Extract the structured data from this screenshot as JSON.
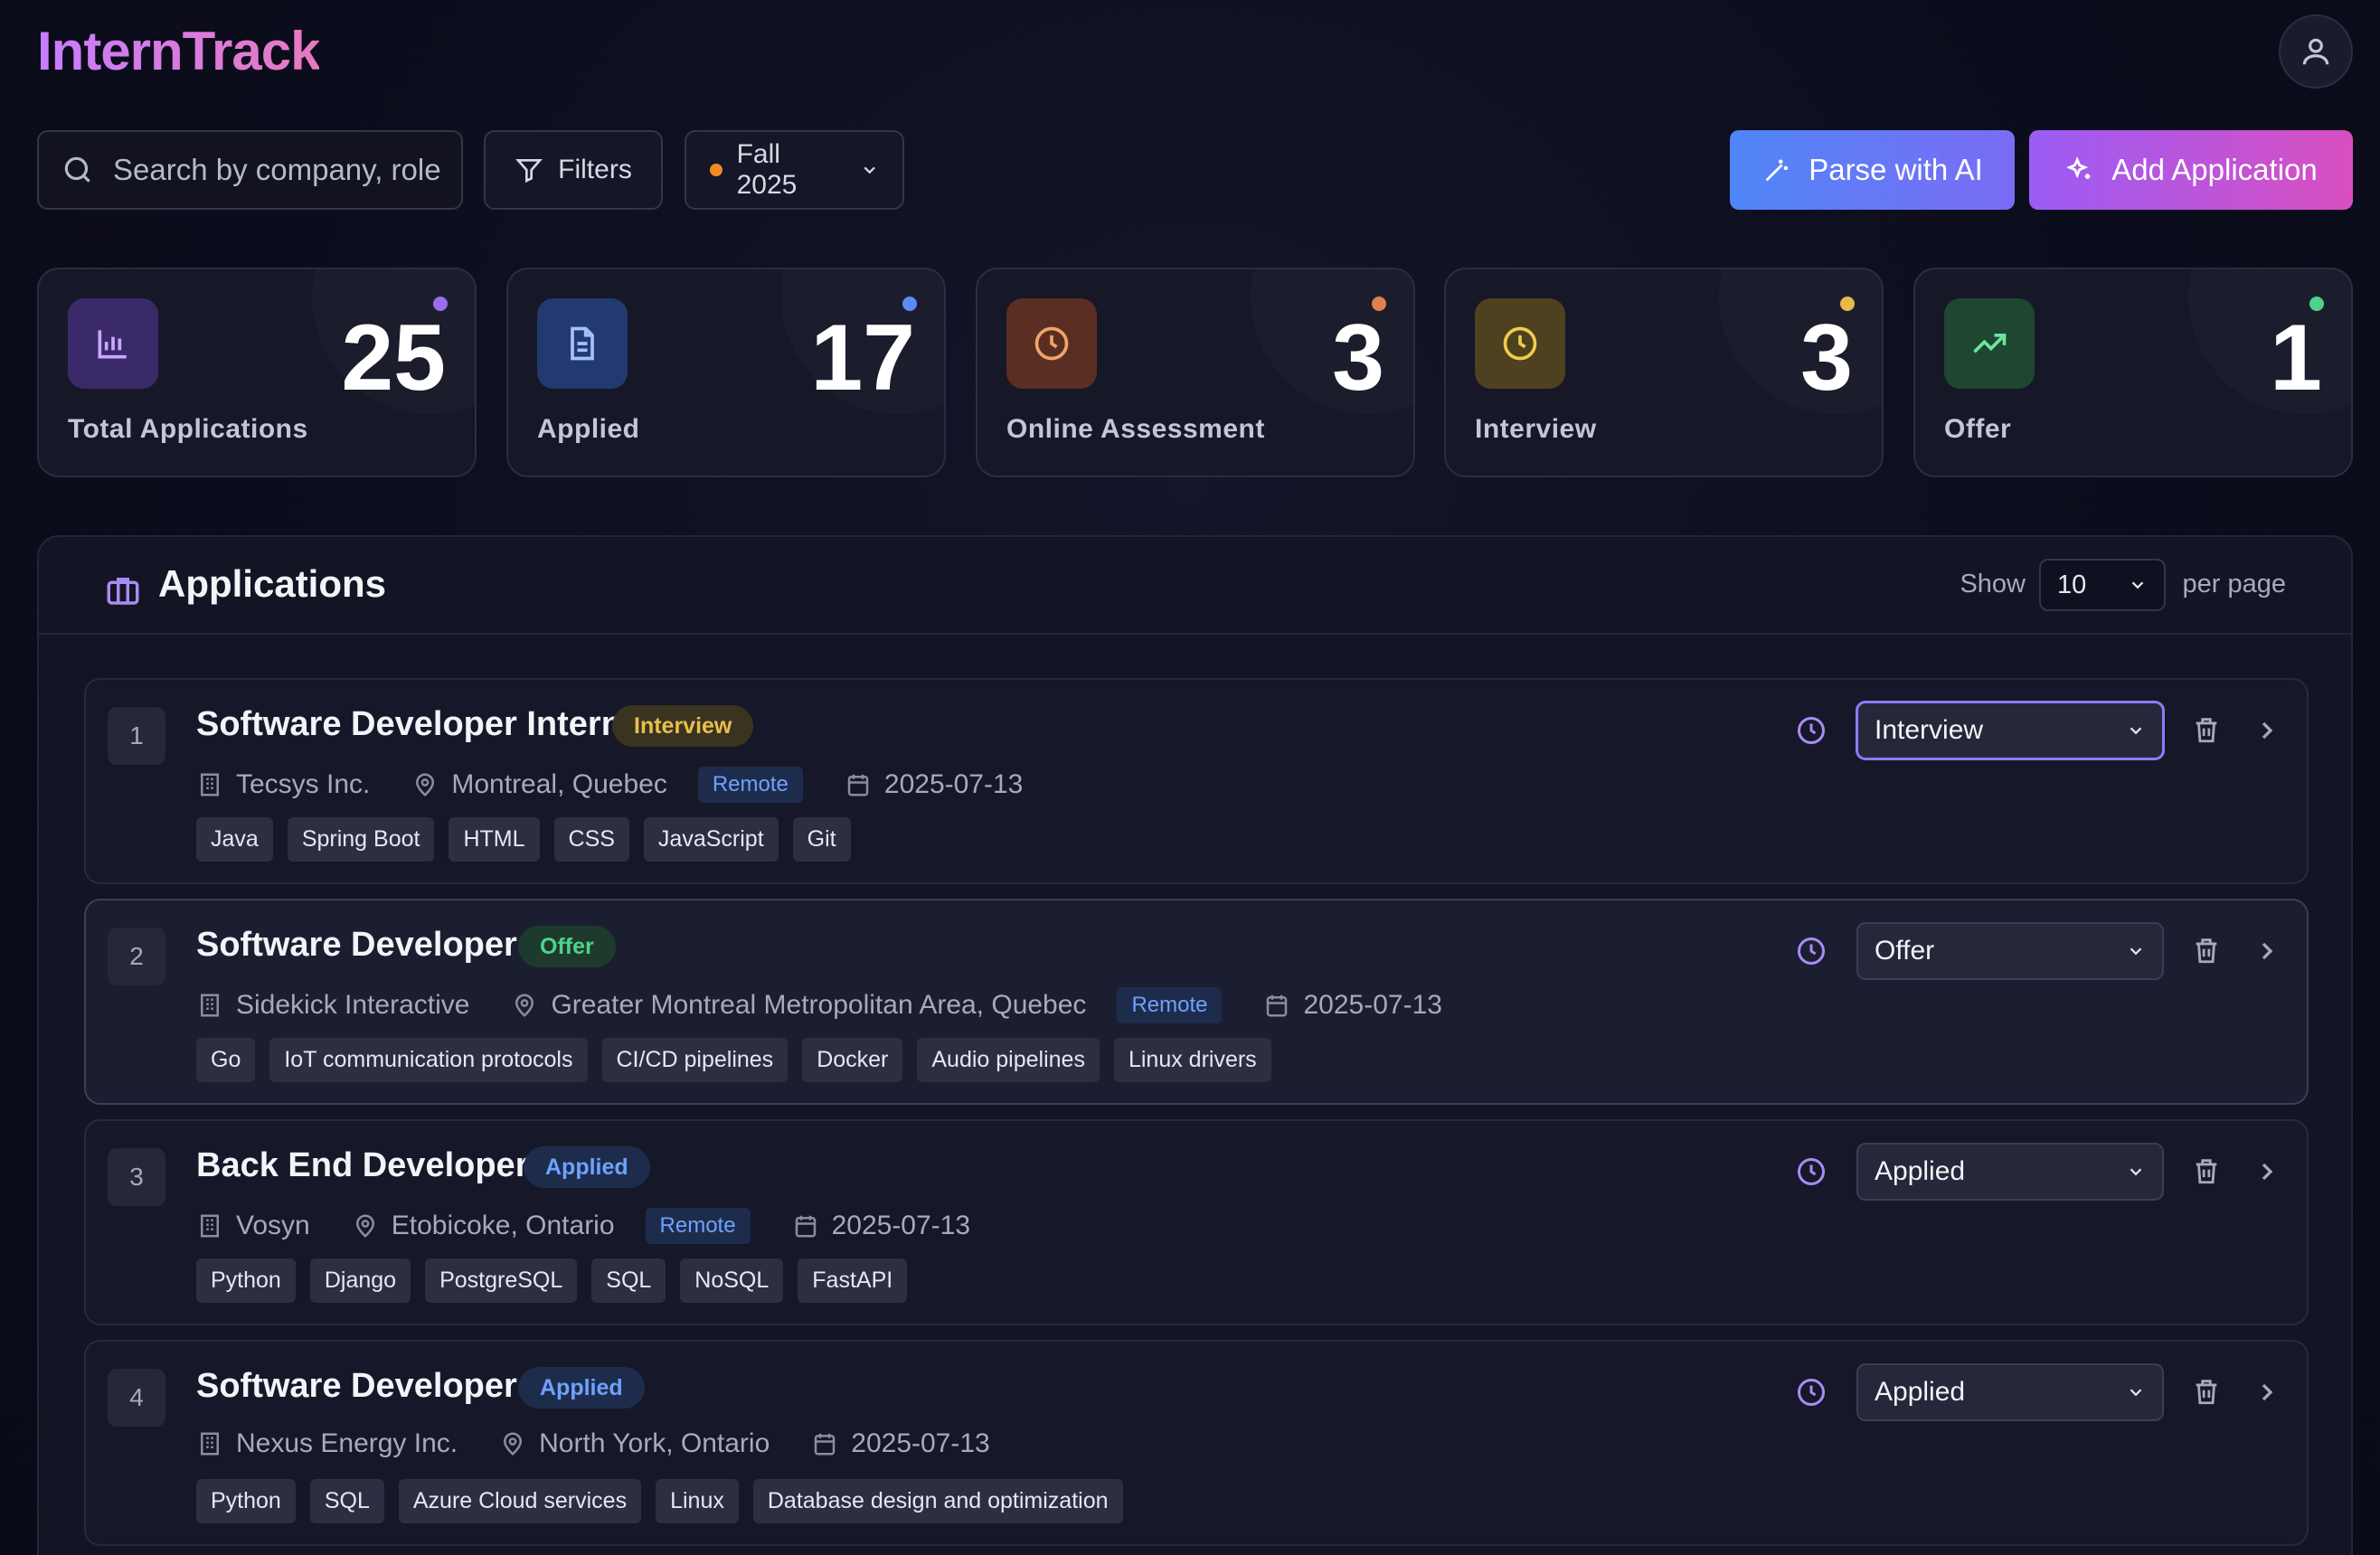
{
  "app": {
    "title": "InternTrack"
  },
  "toolbar": {
    "search_placeholder": "Search by company, role",
    "filters_label": "Filters",
    "season_label": "Fall 2025",
    "parse_label": "Parse with AI",
    "add_label": "Add Application"
  },
  "stats": [
    {
      "label": "Total Applications",
      "value": "25",
      "color": "#9b6bf0",
      "icon": "bar-chart-icon"
    },
    {
      "label": "Applied",
      "value": "17",
      "color": "#5b8bf5",
      "icon": "document-icon"
    },
    {
      "label": "Online Assessment",
      "value": "3",
      "color": "#e0804a",
      "icon": "clock-icon"
    },
    {
      "label": "Interview",
      "value": "3",
      "color": "#e8b84a",
      "icon": "clock-icon"
    },
    {
      "label": "Offer",
      "value": "1",
      "color": "#4ed38a",
      "icon": "trending-up-icon"
    }
  ],
  "applications_panel": {
    "title": "Applications",
    "show_label": "Show",
    "per_page_value": "10",
    "per_page_label": "per page"
  },
  "applications": [
    {
      "index": "1",
      "title": "Software Developer Intern",
      "status_badge": "Interview",
      "company": "Tecsys Inc.",
      "location": "Montreal, Quebec",
      "remote": "Remote",
      "date": "2025-07-13",
      "tags": [
        "Java",
        "Spring Boot",
        "HTML",
        "CSS",
        "JavaScript",
        "Git"
      ],
      "status_value": "Interview"
    },
    {
      "index": "2",
      "title": "Software Developer",
      "status_badge": "Offer",
      "company": "Sidekick Interactive",
      "location": "Greater Montreal Metropolitan Area, Quebec",
      "remote": "Remote",
      "date": "2025-07-13",
      "tags": [
        "Go",
        "IoT communication protocols",
        "CI/CD pipelines",
        "Docker",
        "Audio pipelines",
        "Linux drivers"
      ],
      "status_value": "Offer"
    },
    {
      "index": "3",
      "title": "Back End Developer",
      "status_badge": "Applied",
      "company": "Vosyn",
      "location": "Etobicoke, Ontario",
      "remote": "Remote",
      "date": "2025-07-13",
      "tags": [
        "Python",
        "Django",
        "PostgreSQL",
        "SQL",
        "NoSQL",
        "FastAPI"
      ],
      "status_value": "Applied"
    },
    {
      "index": "4",
      "title": "Software Developer",
      "status_badge": "Applied",
      "company": "Nexus Energy Inc.",
      "location": "North York, Ontario",
      "remote": "",
      "date": "2025-07-13",
      "tags": [
        "Python",
        "SQL",
        "Azure Cloud services",
        "Linux",
        "Database design and optimization"
      ],
      "status_value": "Applied"
    }
  ]
}
